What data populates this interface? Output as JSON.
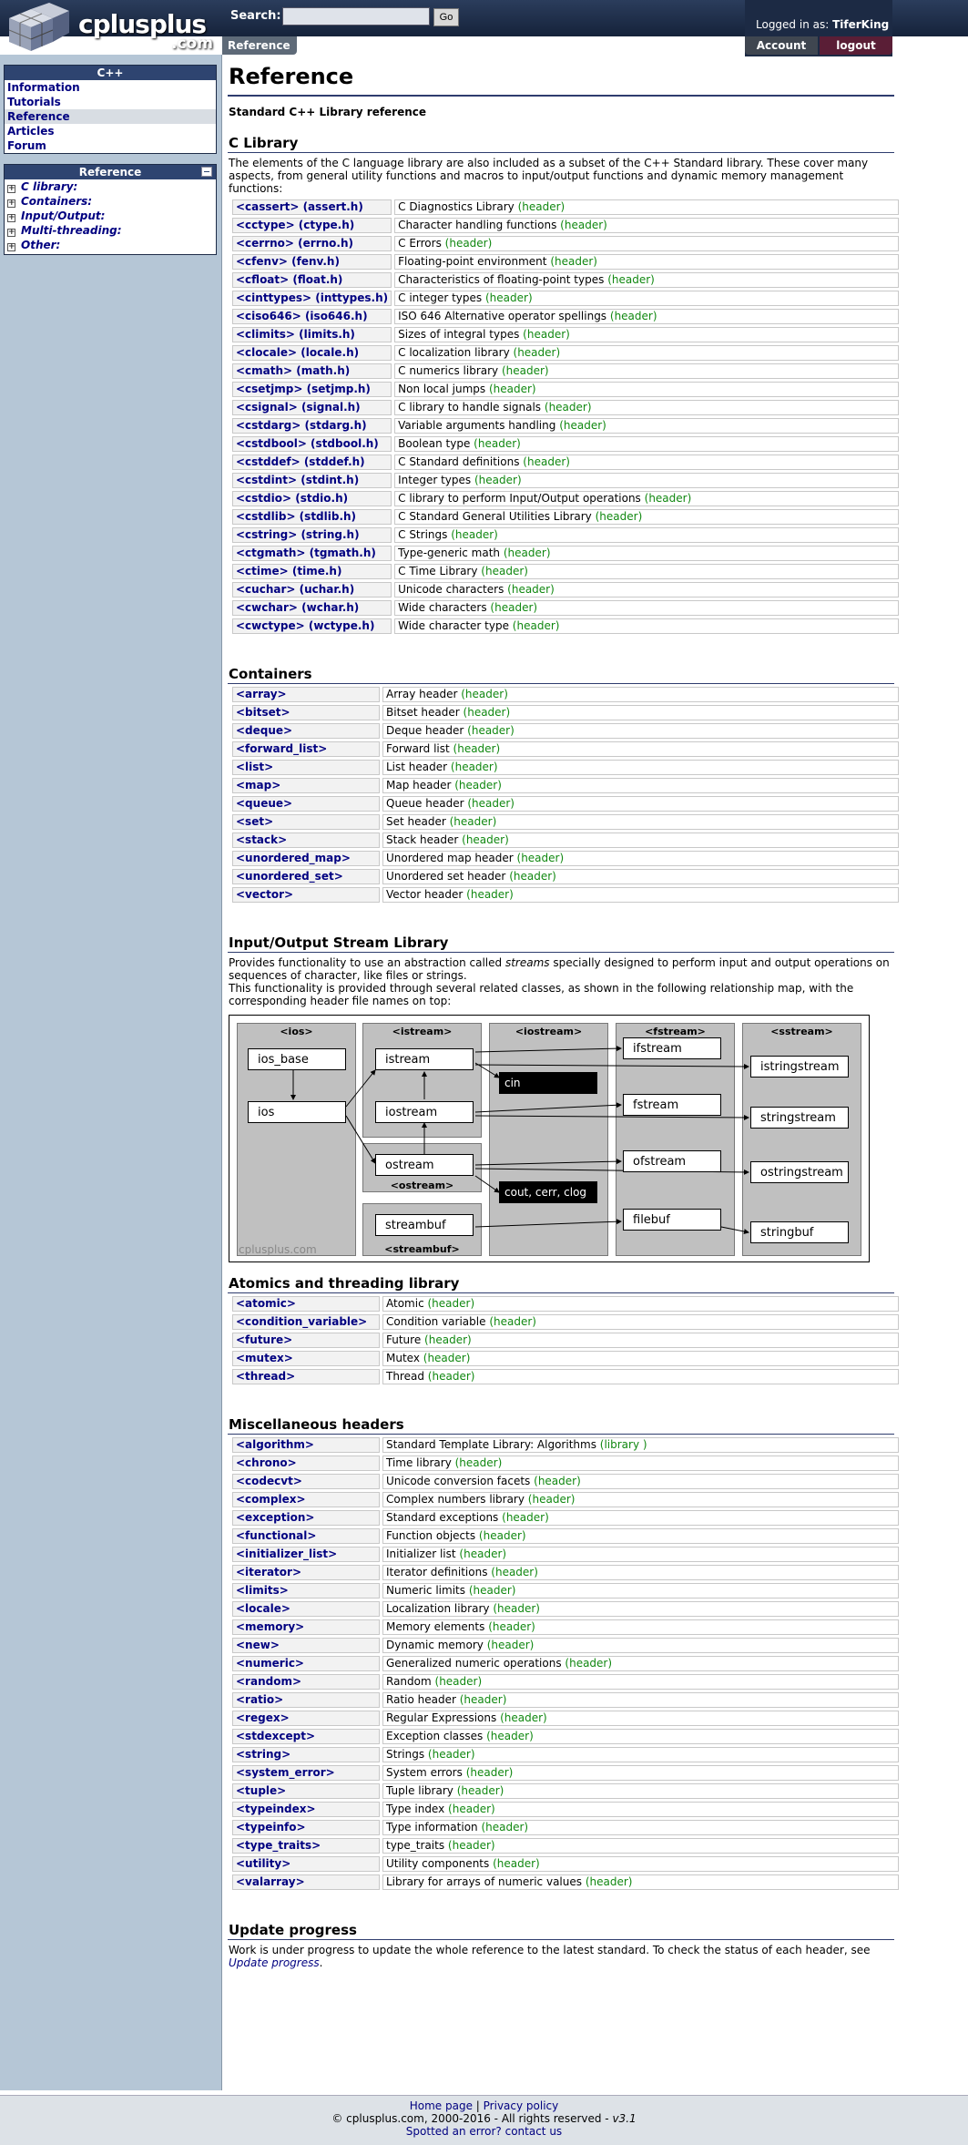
{
  "header": {
    "brand": "cplusplus",
    "brand_suffix": ".com",
    "search_label": "Search:",
    "search_value": "",
    "search_go": "Go",
    "current_tab": "Reference",
    "logged_in_prefix": "Logged in as:",
    "username": "TiferKing",
    "account": "Account",
    "logout": "logout"
  },
  "sidebar": {
    "cpp_title": "C++",
    "cpp_items": [
      {
        "label": "Information"
      },
      {
        "label": "Tutorials"
      },
      {
        "label": "Reference"
      },
      {
        "label": "Articles"
      },
      {
        "label": "Forum"
      }
    ],
    "ref_title": "Reference",
    "ref_items": [
      {
        "label": "C library:"
      },
      {
        "label": "Containers:"
      },
      {
        "label": "Input/Output:"
      },
      {
        "label": "Multi-threading:"
      },
      {
        "label": "Other:"
      }
    ]
  },
  "main": {
    "title": "Reference",
    "subtitle": "Standard C++ Library reference",
    "clib": {
      "heading": "C Library",
      "desc": "The elements of the C language library are also included as a subset of the C++ Standard library. These cover many aspects, from general utility functions and macros to input/output functions and dynamic memory management functions:",
      "rows": [
        {
          "h": "<cassert> (assert.h)",
          "d": "C Diagnostics Library",
          "t": "(header)"
        },
        {
          "h": "<cctype> (ctype.h)",
          "d": "Character handling functions",
          "t": "(header)"
        },
        {
          "h": "<cerrno> (errno.h)",
          "d": "C Errors",
          "t": "(header)"
        },
        {
          "h": "<cfenv> (fenv.h)",
          "d": "Floating-point environment",
          "t": "(header)"
        },
        {
          "h": "<cfloat> (float.h)",
          "d": "Characteristics of floating-point types",
          "t": "(header)"
        },
        {
          "h": "<cinttypes> (inttypes.h)",
          "d": "C integer types",
          "t": "(header)"
        },
        {
          "h": "<ciso646> (iso646.h)",
          "d": "ISO 646 Alternative operator spellings",
          "t": "(header)"
        },
        {
          "h": "<climits> (limits.h)",
          "d": "Sizes of integral types",
          "t": "(header)"
        },
        {
          "h": "<clocale> (locale.h)",
          "d": "C localization library",
          "t": "(header)"
        },
        {
          "h": "<cmath> (math.h)",
          "d": "C numerics library",
          "t": "(header)"
        },
        {
          "h": "<csetjmp> (setjmp.h)",
          "d": "Non local jumps",
          "t": "(header)"
        },
        {
          "h": "<csignal> (signal.h)",
          "d": "C library to handle signals",
          "t": "(header)"
        },
        {
          "h": "<cstdarg> (stdarg.h)",
          "d": "Variable arguments handling",
          "t": "(header)"
        },
        {
          "h": "<cstdbool> (stdbool.h)",
          "d": "Boolean type",
          "t": "(header)"
        },
        {
          "h": "<cstddef> (stddef.h)",
          "d": "C Standard definitions",
          "t": "(header)"
        },
        {
          "h": "<cstdint> (stdint.h)",
          "d": "Integer types",
          "t": "(header)"
        },
        {
          "h": "<cstdio> (stdio.h)",
          "d": "C library to perform Input/Output operations",
          "t": "(header)"
        },
        {
          "h": "<cstdlib> (stdlib.h)",
          "d": "C Standard General Utilities Library",
          "t": "(header)"
        },
        {
          "h": "<cstring> (string.h)",
          "d": "C Strings",
          "t": "(header)"
        },
        {
          "h": "<ctgmath> (tgmath.h)",
          "d": "Type-generic math",
          "t": "(header)"
        },
        {
          "h": "<ctime> (time.h)",
          "d": "C Time Library",
          "t": "(header)"
        },
        {
          "h": "<cuchar> (uchar.h)",
          "d": "Unicode characters",
          "t": "(header)"
        },
        {
          "h": "<cwchar> (wchar.h)",
          "d": "Wide characters",
          "t": "(header)"
        },
        {
          "h": "<cwctype> (wctype.h)",
          "d": "Wide character type",
          "t": "(header)"
        }
      ]
    },
    "containers": {
      "heading": "Containers",
      "rows": [
        {
          "h": "<array>",
          "d": "Array header",
          "t": "(header)"
        },
        {
          "h": "<bitset>",
          "d": "Bitset header",
          "t": "(header)"
        },
        {
          "h": "<deque>",
          "d": "Deque header",
          "t": "(header)"
        },
        {
          "h": "<forward_list>",
          "d": "Forward list",
          "t": "(header)"
        },
        {
          "h": "<list>",
          "d": "List header",
          "t": "(header)"
        },
        {
          "h": "<map>",
          "d": "Map header",
          "t": "(header)"
        },
        {
          "h": "<queue>",
          "d": "Queue header",
          "t": "(header)"
        },
        {
          "h": "<set>",
          "d": "Set header",
          "t": "(header)"
        },
        {
          "h": "<stack>",
          "d": "Stack header",
          "t": "(header)"
        },
        {
          "h": "<unordered_map>",
          "d": "Unordered map header",
          "t": "(header)"
        },
        {
          "h": "<unordered_set>",
          "d": "Unordered set header",
          "t": "(header)"
        },
        {
          "h": "<vector>",
          "d": "Vector header",
          "t": "(header)"
        }
      ]
    },
    "io": {
      "heading": "Input/Output Stream Library",
      "desc1_a": "Provides functionality to use an abstraction called ",
      "desc1_em": "streams",
      "desc1_b": " specially designed to perform input and output operations on sequences of character, like files or strings.",
      "desc2": "This functionality is provided through several related classes, as shown in the following relationship map, with the corresponding header file names on top:",
      "map": {
        "col_ios": "<ios>",
        "col_istream": "<istream>",
        "col_iostream": "<iostream>",
        "col_fstream": "<fstream>",
        "col_sstream": "<sstream>",
        "label_ostream": "<ostream>",
        "label_streambuf": "<streambuf>",
        "ios_base": "ios_base",
        "ios": "ios",
        "istream": "istream",
        "iostream": "iostream",
        "ostream": "ostream",
        "streambuf": "streambuf",
        "cin": "cin",
        "cout": "cout, cerr, clog",
        "ifstream": "ifstream",
        "fstream": "fstream",
        "ofstream": "ofstream",
        "filebuf": "filebuf",
        "istringstream": "istringstream",
        "stringstream": "stringstream",
        "ostringstream": "ostringstream",
        "stringbuf": "stringbuf",
        "watermark": "cplusplus.com"
      }
    },
    "atomics": {
      "heading": "Atomics and threading library",
      "rows": [
        {
          "h": "<atomic>",
          "d": "Atomic",
          "t": "(header)"
        },
        {
          "h": "<condition_variable>",
          "d": "Condition variable",
          "t": "(header)"
        },
        {
          "h": "<future>",
          "d": "Future",
          "t": "(header)"
        },
        {
          "h": "<mutex>",
          "d": "Mutex",
          "t": "(header)"
        },
        {
          "h": "<thread>",
          "d": "Thread",
          "t": "(header)"
        }
      ]
    },
    "misc": {
      "heading": "Miscellaneous headers",
      "rows": [
        {
          "h": "<algorithm>",
          "d": "Standard Template Library: Algorithms",
          "t": "(library )"
        },
        {
          "h": "<chrono>",
          "d": "Time library",
          "t": "(header)"
        },
        {
          "h": "<codecvt>",
          "d": "Unicode conversion facets",
          "t": "(header)"
        },
        {
          "h": "<complex>",
          "d": "Complex numbers library",
          "t": "(header)"
        },
        {
          "h": "<exception>",
          "d": "Standard exceptions",
          "t": "(header)"
        },
        {
          "h": "<functional>",
          "d": "Function objects",
          "t": "(header)"
        },
        {
          "h": "<initializer_list>",
          "d": "Initializer list",
          "t": "(header)"
        },
        {
          "h": "<iterator>",
          "d": "Iterator definitions",
          "t": "(header)"
        },
        {
          "h": "<limits>",
          "d": "Numeric limits",
          "t": "(header)"
        },
        {
          "h": "<locale>",
          "d": "Localization library",
          "t": "(header)"
        },
        {
          "h": "<memory>",
          "d": "Memory elements",
          "t": "(header)"
        },
        {
          "h": "<new>",
          "d": "Dynamic memory",
          "t": "(header)"
        },
        {
          "h": "<numeric>",
          "d": "Generalized numeric operations",
          "t": "(header)"
        },
        {
          "h": "<random>",
          "d": "Random",
          "t": "(header)"
        },
        {
          "h": "<ratio>",
          "d": "Ratio header",
          "t": "(header)"
        },
        {
          "h": "<regex>",
          "d": "Regular Expressions",
          "t": "(header)"
        },
        {
          "h": "<stdexcept>",
          "d": "Exception classes",
          "t": "(header)"
        },
        {
          "h": "<string>",
          "d": "Strings",
          "t": "(header)"
        },
        {
          "h": "<system_error>",
          "d": "System errors",
          "t": "(header)"
        },
        {
          "h": "<tuple>",
          "d": "Tuple library",
          "t": "(header)"
        },
        {
          "h": "<typeindex>",
          "d": "Type index",
          "t": "(header)"
        },
        {
          "h": "<typeinfo>",
          "d": "Type information",
          "t": "(header)"
        },
        {
          "h": "<type_traits>",
          "d": "type_traits",
          "t": "(header)"
        },
        {
          "h": "<utility>",
          "d": "Utility components",
          "t": "(header)"
        },
        {
          "h": "<valarray>",
          "d": "Library for arrays of numeric values",
          "t": "(header)"
        }
      ]
    },
    "update": {
      "heading": "Update progress",
      "text": "Work is under progress to update the whole reference to the latest standard. To check the status of each header, see ",
      "link": "Update progress",
      "end": "."
    }
  },
  "footer": {
    "home": "Home page",
    "sep": " | ",
    "privacy": "Privacy policy",
    "copyright": "© cplusplus.com, 2000-2016 - All rights reserved - ",
    "version": "v3.1",
    "error": "Spotted an error? contact us"
  },
  "colors": {
    "header_bg": "#15223a",
    "sidebar_bg": "#b5c6d6",
    "link": "#000080",
    "header_tag": "#118811",
    "rule": "#2e3c6e"
  }
}
